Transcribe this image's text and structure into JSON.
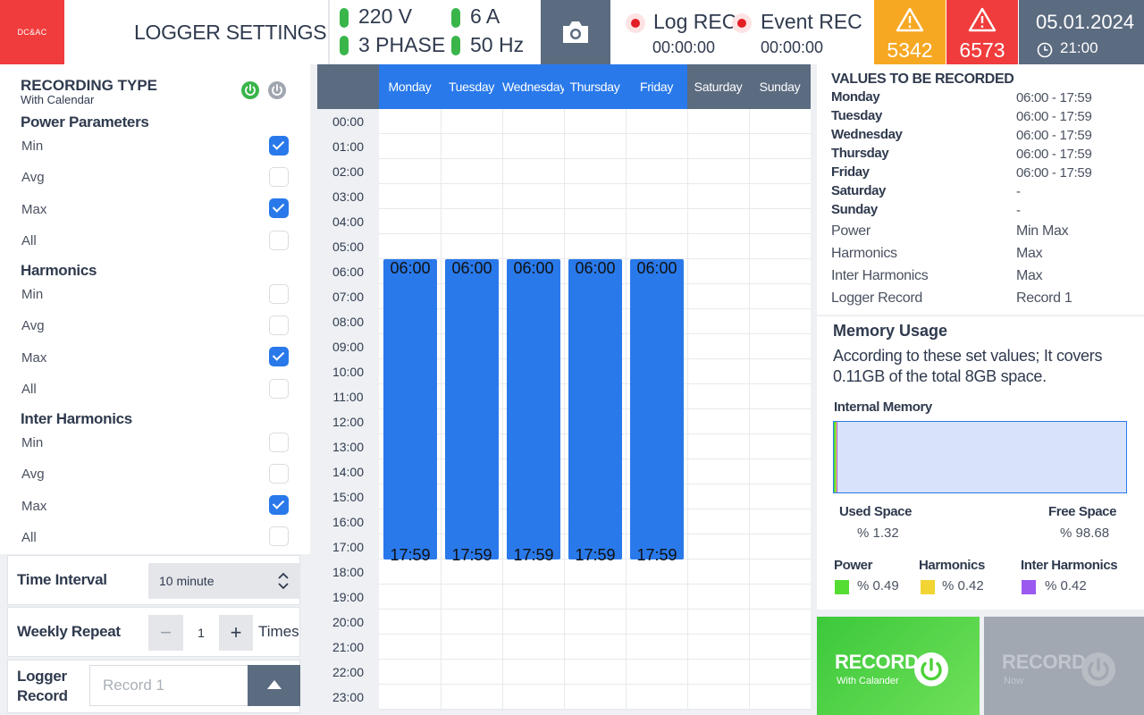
{
  "header": {
    "logo": "DC&AC",
    "title": "LOGGER SETTINGS",
    "voltage": "220 V",
    "phase": "3 PHASE",
    "current": "6 A",
    "frequency": "50 Hz",
    "log_rec_label": "Log REC",
    "log_rec_time": "00:00:00",
    "event_rec_label": "Event REC",
    "event_rec_time": "00:00:00",
    "alarm_warning_count": "5342",
    "alarm_critical_count": "6573",
    "date": "05.01.2024",
    "time": "21:00"
  },
  "recording_type": {
    "title": "RECORDING TYPE",
    "subtitle": "With Calendar",
    "sections": [
      {
        "label": "Power Parameters",
        "options": [
          {
            "label": "Min",
            "checked": true
          },
          {
            "label": "Avg",
            "checked": false
          },
          {
            "label": "Max",
            "checked": true
          },
          {
            "label": "All",
            "checked": false
          }
        ]
      },
      {
        "label": "Harmonics",
        "options": [
          {
            "label": "Min",
            "checked": false
          },
          {
            "label": "Avg",
            "checked": false
          },
          {
            "label": "Max",
            "checked": true
          },
          {
            "label": "All",
            "checked": false
          }
        ]
      },
      {
        "label": "Inter Harmonics",
        "options": [
          {
            "label": "Min",
            "checked": false
          },
          {
            "label": "Avg",
            "checked": false
          },
          {
            "label": "Max",
            "checked": true
          },
          {
            "label": "All",
            "checked": false
          }
        ]
      }
    ]
  },
  "controls": {
    "time_interval_label": "Time Interval",
    "time_interval_value": "10 minute",
    "weekly_repeat_label": "Weekly Repeat",
    "weekly_repeat_value": "1",
    "weekly_repeat_minus": "−",
    "weekly_repeat_plus": "+",
    "weekly_repeat_unit": "Times",
    "logger_record_label_1": "Logger",
    "logger_record_label_2": "Record",
    "logger_record_placeholder": "Record 1"
  },
  "calendar": {
    "days": [
      {
        "label": "Monday",
        "active": true
      },
      {
        "label": "Tuesday",
        "active": true
      },
      {
        "label": "Wednesday",
        "active": true
      },
      {
        "label": "Thursday",
        "active": true
      },
      {
        "label": "Friday",
        "active": true
      },
      {
        "label": "Saturday",
        "active": false
      },
      {
        "label": "Sunday",
        "active": false
      }
    ],
    "hours": [
      "00:00",
      "01:00",
      "02:00",
      "03:00",
      "04:00",
      "05:00",
      "06:00",
      "07:00",
      "08:00",
      "09:00",
      "10:00",
      "11:00",
      "12:00",
      "13:00",
      "14:00",
      "15:00",
      "16:00",
      "17:00",
      "18:00",
      "19:00",
      "20:00",
      "21:00",
      "22:00",
      "23:00"
    ],
    "blocks": [
      {
        "day": "Monday",
        "start": "06:00",
        "end": "17:59"
      },
      {
        "day": "Tuesday",
        "start": "06:00",
        "end": "17:59"
      },
      {
        "day": "Wednesday",
        "start": "06:00",
        "end": "17:59"
      },
      {
        "day": "Thursday",
        "start": "06:00",
        "end": "17:59"
      },
      {
        "day": "Friday",
        "start": "06:00",
        "end": "17:59"
      }
    ]
  },
  "values": {
    "title": "VALUES TO BE RECORDED",
    "schedule": [
      {
        "day": "Monday",
        "value": "06:00 - 17:59"
      },
      {
        "day": "Tuesday",
        "value": "06:00 - 17:59"
      },
      {
        "day": "Wednesday",
        "value": "06:00 - 17:59"
      },
      {
        "day": "Thursday",
        "value": "06:00 - 17:59"
      },
      {
        "day": "Friday",
        "value": "06:00 - 17:59"
      },
      {
        "day": "Saturday",
        "value": "-"
      },
      {
        "day": "Sunday",
        "value": "-"
      }
    ],
    "params": [
      {
        "key": "Power",
        "value": "Min  Max"
      },
      {
        "key": "Harmonics",
        "value": "Max"
      },
      {
        "key": "Inter Harmonics",
        "value": "Max"
      },
      {
        "key": "Logger Record",
        "value": "Record 1"
      }
    ]
  },
  "memory": {
    "title": "Memory Usage",
    "description": "According to these set values; It covers 0.11GB of the total 8GB space.",
    "internal_label": "Internal Memory",
    "used_label": "Used Space",
    "used_value": "% 1.32",
    "used_fraction": 0.0132,
    "free_label": "Free Space",
    "free_value": "% 98.68",
    "legend": [
      {
        "label": "Power",
        "value": "% 0.49",
        "color": "#55dd33",
        "fraction": 0.0049
      },
      {
        "label": "Harmonics",
        "value": "% 0.42",
        "color": "#f2d533",
        "fraction": 0.0042
      },
      {
        "label": "Inter Harmonics",
        "value": "% 0.42",
        "color": "#9b59f0",
        "fraction": 0.0042
      }
    ]
  },
  "record_buttons": {
    "calendar_title": "RECORD",
    "calendar_sub": "With Calander",
    "now_title": "RECORD",
    "now_sub": "Now"
  },
  "colors": {
    "accent": "#2979ea",
    "slate": "#5b6b80",
    "ok": "#39b54a",
    "warning": "#f7a823",
    "critical": "#f03c3c",
    "record_active": "#4cd137"
  }
}
